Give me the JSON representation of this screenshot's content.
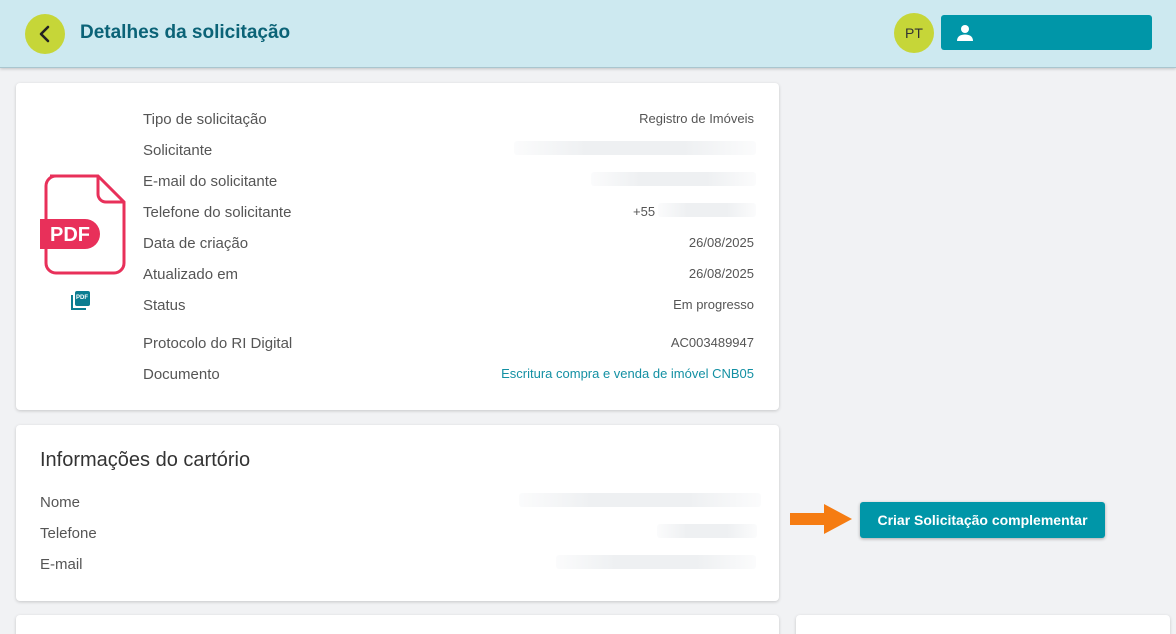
{
  "header": {
    "title": "Detalhes da solicitação",
    "avatar_initials": "PT",
    "back_icon": "chevron-left-icon",
    "user_icon": "person-icon"
  },
  "request": {
    "file_badge": "PDF",
    "small_pdf_icon_label": "PDF",
    "rows": [
      {
        "label": "Tipo de solicitação",
        "value": "Registro de Imóveis"
      },
      {
        "label": "Solicitante",
        "value": ""
      },
      {
        "label": "E-mail do solicitante",
        "value": ""
      },
      {
        "label": "Telefone do solicitante",
        "value": "+55"
      },
      {
        "label": "Data de criação",
        "value": "26/08/2025"
      },
      {
        "label": "Atualizado em",
        "value": "26/08/2025"
      },
      {
        "label": "Status",
        "value": "Em progresso"
      },
      {
        "label": "Protocolo do RI Digital",
        "value": "AC003489947"
      },
      {
        "label": "Documento",
        "value": "Escritura compra e venda de imóvel CNB05"
      }
    ]
  },
  "registry": {
    "title": "Informações do cartório",
    "rows": [
      {
        "label": "Nome",
        "value": ""
      },
      {
        "label": "Telefone",
        "value": ""
      },
      {
        "label": "E-mail",
        "value": ""
      }
    ]
  },
  "actions": {
    "create_complementary": "Criar Solicitação complementar"
  },
  "colors": {
    "header_bg": "#cde9f0",
    "accent": "#0096a8",
    "lime": "#c6d638",
    "pdf_red": "#e8305a",
    "arrow_orange": "#f57c12"
  }
}
